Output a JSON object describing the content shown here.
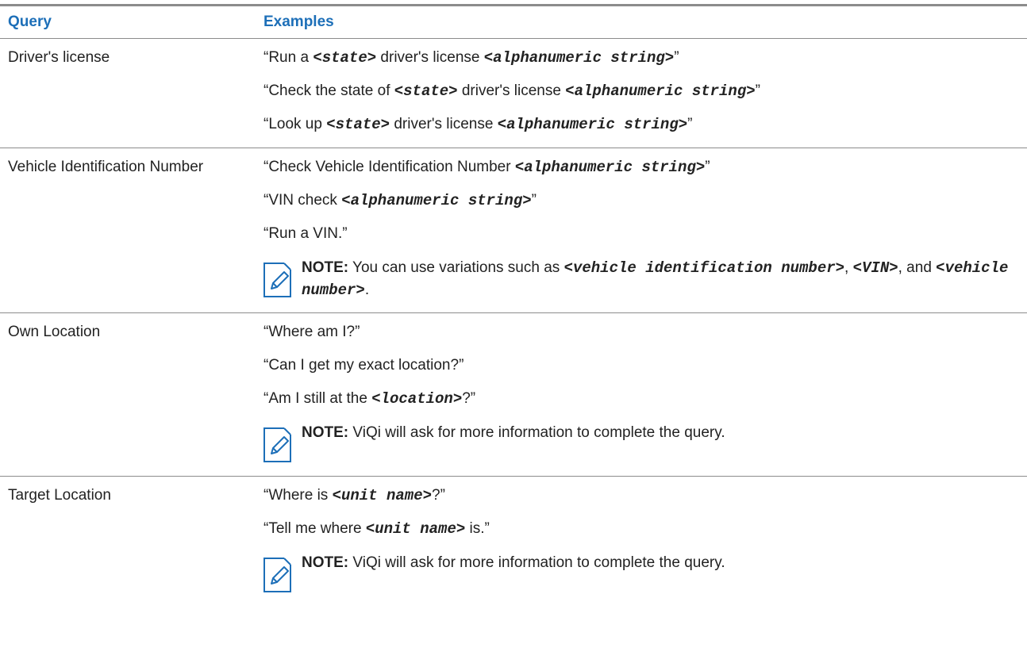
{
  "header": {
    "query": "Query",
    "examples": "Examples"
  },
  "rows": [
    {
      "query": "Driver's license",
      "examples": [
        {
          "p1": "“Run a ",
          "ph1": "<state>",
          "p2": " driver's license ",
          "ph2": "<alphanumeric string>",
          "p3": "”"
        },
        {
          "p1": "“Check the state of ",
          "ph1": "<state>",
          "p2": " driver's license ",
          "ph2": "<alphanumeric string>",
          "p3": "”"
        },
        {
          "p1": "“Look up ",
          "ph1": "<state>",
          "p2": " driver's license ",
          "ph2": "<alphanumeric string>",
          "p3": "”"
        }
      ]
    },
    {
      "query": "Vehicle Identification Number",
      "examples": [
        {
          "p1": "“Check Vehicle Identification Number ",
          "ph1": "<alphanumeric string>",
          "p2": "”"
        },
        {
          "p1": "“VIN check ",
          "ph1": "<alphanumeric string>",
          "p2": "”"
        },
        {
          "p1": "“Run a VIN.”"
        }
      ],
      "note": {
        "label": "NOTE:",
        "t1": " You can use variations such as ",
        "ph1": "<vehicle identification number>",
        "t2": ", ",
        "ph2": "<VIN>",
        "t3": ", and ",
        "ph3": "<vehicle number>",
        "t4": "."
      }
    },
    {
      "query": "Own Location",
      "examples": [
        {
          "p1": "“Where am I?”"
        },
        {
          "p1": "“Can I get my exact location?”"
        },
        {
          "p1": "“Am I still at the ",
          "ph1": "<location>",
          "p2": "?”"
        }
      ],
      "note": {
        "label": "NOTE:",
        "t1": " ViQi will ask for more information to complete the query."
      }
    },
    {
      "query": "Target Location",
      "examples": [
        {
          "p1": "“Where is ",
          "ph1": "<unit name>",
          "p2": "?”"
        },
        {
          "p1": "“Tell me where ",
          "ph1": "<unit name>",
          "p2": " is.”"
        }
      ],
      "note": {
        "label": "NOTE:",
        "t1": " ViQi will ask for more information to complete the query."
      }
    }
  ]
}
